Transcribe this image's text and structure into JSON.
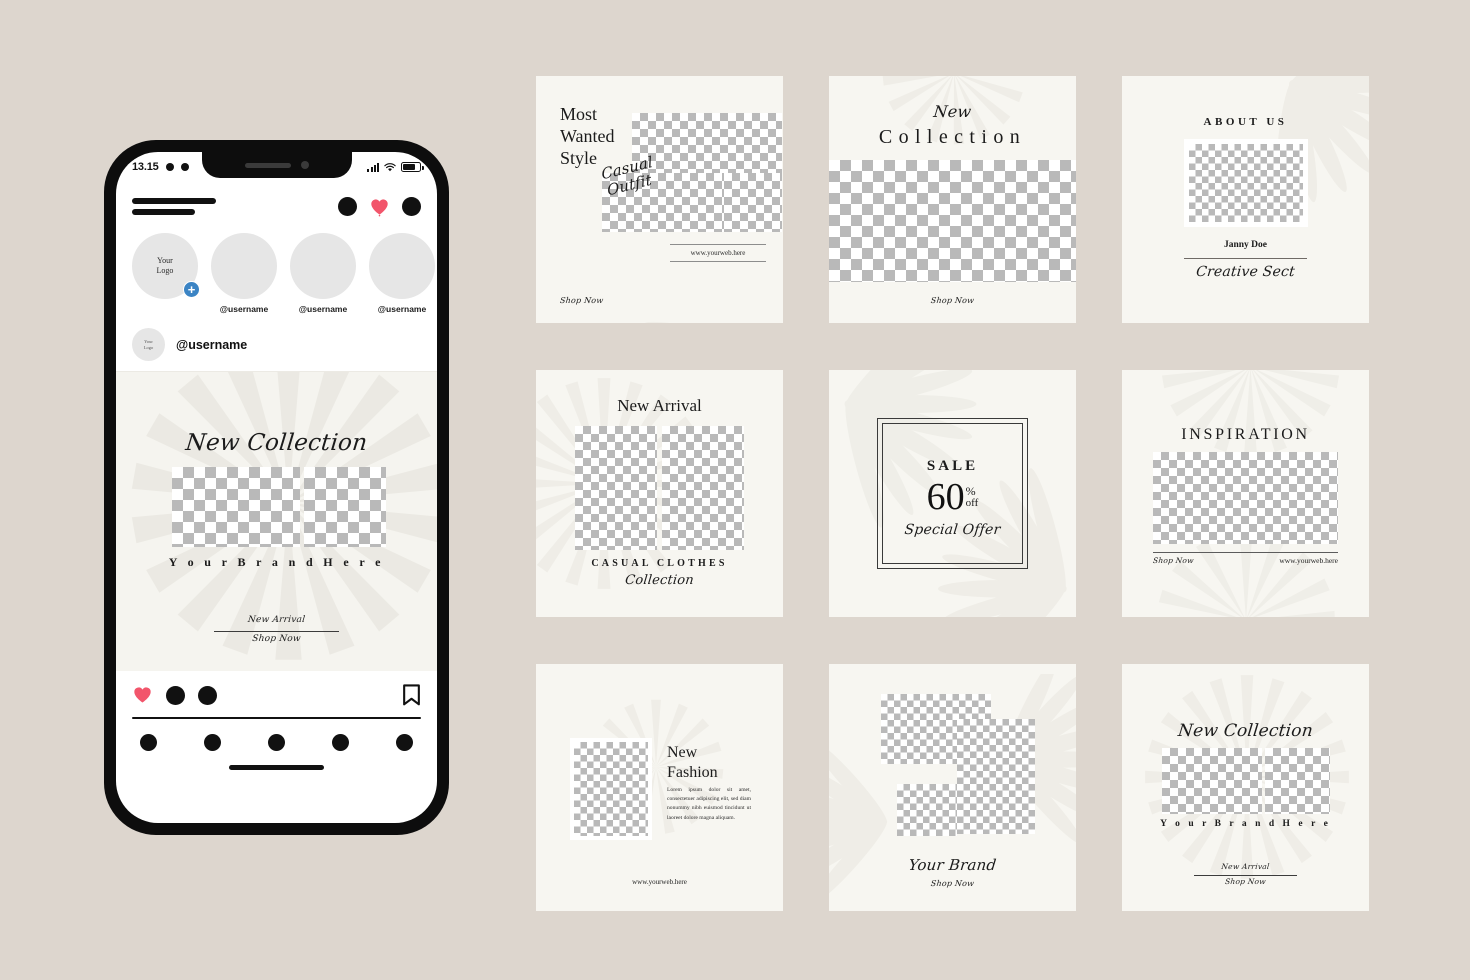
{
  "theme": {
    "page_bg": "#ddd6ce",
    "card_bg": "#f7f6f1",
    "ink": "#1b1b1b",
    "heart_red": "#f2556b",
    "plus_blue": "#3b84c4",
    "checker_gray": "#b9b9b9"
  },
  "phone": {
    "status": {
      "time": "13.15",
      "signal_icon": "signal-bars-icon",
      "wifi_icon": "wifi-icon",
      "battery_icon": "battery-icon"
    },
    "header": {
      "logo": "brand-logo-lines",
      "icons": [
        "messenger-dot-icon",
        "heart-icon",
        "profile-dot-icon"
      ]
    },
    "stories": [
      {
        "label": "Your\nLogo",
        "username": "",
        "has_add": true,
        "add_label": "+"
      },
      {
        "label": "",
        "username": "@username",
        "has_add": false
      },
      {
        "label": "",
        "username": "@username",
        "has_add": false
      },
      {
        "label": "",
        "username": "@username",
        "has_add": false
      }
    ],
    "post_user": {
      "avatar_label": "Your\nLogo",
      "username": "@username"
    },
    "post": {
      "script_title": "New Collection",
      "brand": "Y o u r   B r a n d   H e r e",
      "cta_primary": "New Arrival",
      "cta_secondary": "Shop Now"
    },
    "actions": {
      "like": "heart-icon",
      "comment": "comment-dot-icon",
      "share": "share-dot-icon",
      "save": "bookmark-icon"
    },
    "navbar": [
      "home-dot-icon",
      "search-dot-icon",
      "reels-dot-icon",
      "shop-dot-icon",
      "profile-dot-icon"
    ]
  },
  "cards": [
    {
      "id": "most-wanted-style",
      "title": "Most\nWanted\nStyle",
      "script": "Casual\nOutfit",
      "web": "www.yourweb.here",
      "shop": "Shop Now"
    },
    {
      "id": "new-collection",
      "script": "New",
      "title": "Collection",
      "shop": "Shop Now"
    },
    {
      "id": "about-us",
      "title": "ABOUT US",
      "name": "Janny Doe",
      "script": "Creative Sect"
    },
    {
      "id": "new-arrival",
      "title": "New Arrival",
      "subtitle": "CASUAL CLOTHES",
      "script": "Collection"
    },
    {
      "id": "sale-60-off",
      "sale": "SALE",
      "number": "60",
      "percent": "%",
      "off": "off",
      "script": "Special Offer"
    },
    {
      "id": "inspiration",
      "title": "INSPIRATION",
      "shop": "Shop Now",
      "web": "www.yourweb.here"
    },
    {
      "id": "new-fashion",
      "title": "New\nFashion",
      "body": "Lorem ipsum dolor sit amet, consectetuer adipiscing elit, sed diam nonummy nibh euismod tincidunt ut laoreet dolore magna aliquam.",
      "web": "www.yourweb.here"
    },
    {
      "id": "your-brand",
      "script": "Your Brand",
      "shop": "Shop Now"
    },
    {
      "id": "new-collection-brand",
      "script": "New Collection",
      "brand": "Y o u r   B r a n d   H e r e",
      "cta_primary": "New Arrival",
      "cta_secondary": "Shop Now"
    }
  ]
}
